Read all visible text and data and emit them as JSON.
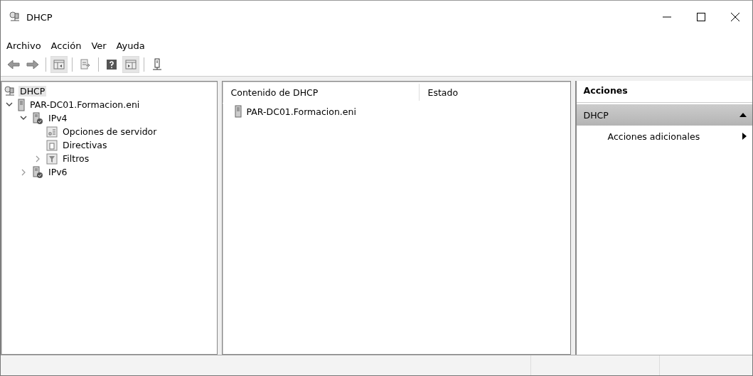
{
  "window": {
    "title": "DHCP"
  },
  "menu": [
    "Archivo",
    "Acción",
    "Ver",
    "Ayuda"
  ],
  "toolbar": [
    {
      "kind": "back",
      "on": false
    },
    {
      "kind": "forward",
      "on": false
    },
    {
      "kind": "sep"
    },
    {
      "kind": "tree",
      "on": true
    },
    {
      "kind": "sep"
    },
    {
      "kind": "export",
      "on": false
    },
    {
      "kind": "sep"
    },
    {
      "kind": "help",
      "on": false
    },
    {
      "kind": "actionpane",
      "on": true
    },
    {
      "kind": "sep"
    },
    {
      "kind": "server",
      "on": false
    }
  ],
  "tree": [
    {
      "label": "DHCP",
      "kind": "dhcp",
      "selected": true,
      "children": [
        {
          "label": "PAR-DC01.Formacion.eni",
          "kind": "server",
          "selected": false,
          "expanded": true,
          "children": [
            {
              "label": "IPv4",
              "kind": "protocol",
              "selected": false,
              "expanded": true,
              "children": [
                {
                  "label": "Opciones de servidor",
                  "kind": "options",
                  "selected": false
                },
                {
                  "label": "Directivas",
                  "kind": "policies",
                  "selected": false
                },
                {
                  "label": "Filtros",
                  "kind": "filter",
                  "selected": false,
                  "expanded": false
                }
              ]
            },
            {
              "label": "IPv6",
              "kind": "protocol",
              "selected": false,
              "expanded": false
            }
          ]
        }
      ]
    }
  ],
  "list": {
    "columns": [
      "Contenido de DHCP",
      "Estado"
    ],
    "rows": [
      {
        "kind": "server",
        "cells": [
          "PAR-DC01.Formacion.eni",
          ""
        ]
      }
    ]
  },
  "actions": {
    "title": "Acciones",
    "sections": [
      {
        "label": "DHCP",
        "expanded": true,
        "items": [
          {
            "label": "Acciones adicionales",
            "submenu": true
          }
        ]
      }
    ]
  }
}
